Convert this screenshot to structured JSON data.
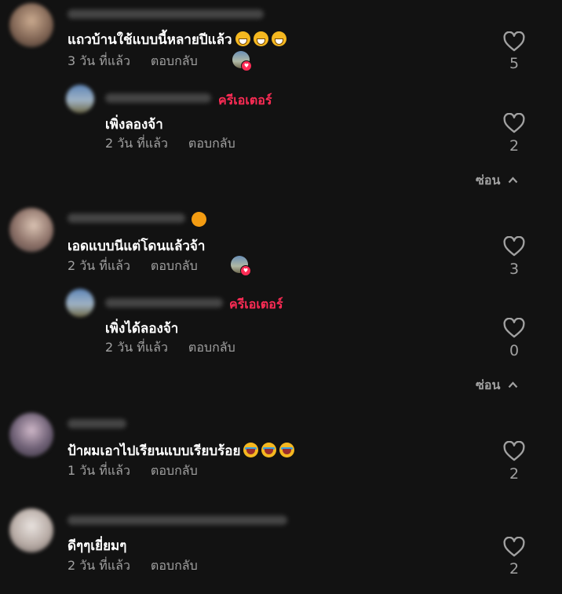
{
  "comments": [
    {
      "name_blurred": "ผู้ใช้ (ชื่อเบลอ)",
      "text": "แถวบ้านใช้แบบนี้หลายปีแล้ว",
      "time": "3 วัน ที่แล้ว",
      "reply": "ตอบกลับ",
      "likes": "5"
    },
    {
      "text": "เพิ่งลองจ้า",
      "time": "2 วัน ที่แล้ว",
      "reply": "ตอบกลับ",
      "likes": "2",
      "creator": "ครีเอเตอร์"
    },
    {
      "text": "เอดแบบนีแต่โดนแล้วจ้า",
      "time": "2 วัน ที่แล้ว",
      "reply": "ตอบกลับ",
      "likes": "3"
    },
    {
      "text": "เพิ่งได้ลองจ้า",
      "time": "2 วัน ที่แล้ว",
      "reply": "ตอบกลับ",
      "likes": "0",
      "creator": "ครีเอเตอร์"
    },
    {
      "text": "ป้าผมเอาไปเรียนแบบเรียบร้อย",
      "time": "1 วัน ที่แล้ว",
      "reply": "ตอบกลับ",
      "likes": "2"
    },
    {
      "text": "ดีๆๆเยี่ยมๆ",
      "time": "2 วัน ที่แล้ว",
      "reply": "ตอบกลับ",
      "likes": "2"
    }
  ],
  "hide_label": "ซ่อน",
  "icons": {
    "heart": "heart-outline-icon",
    "chevron": "chevron-up-icon",
    "creator_liked": "creator-liked-badge-icon"
  },
  "colors": {
    "background": "#121212",
    "secondary_text": "#a1a1a1",
    "accent": "#fe2c55"
  }
}
